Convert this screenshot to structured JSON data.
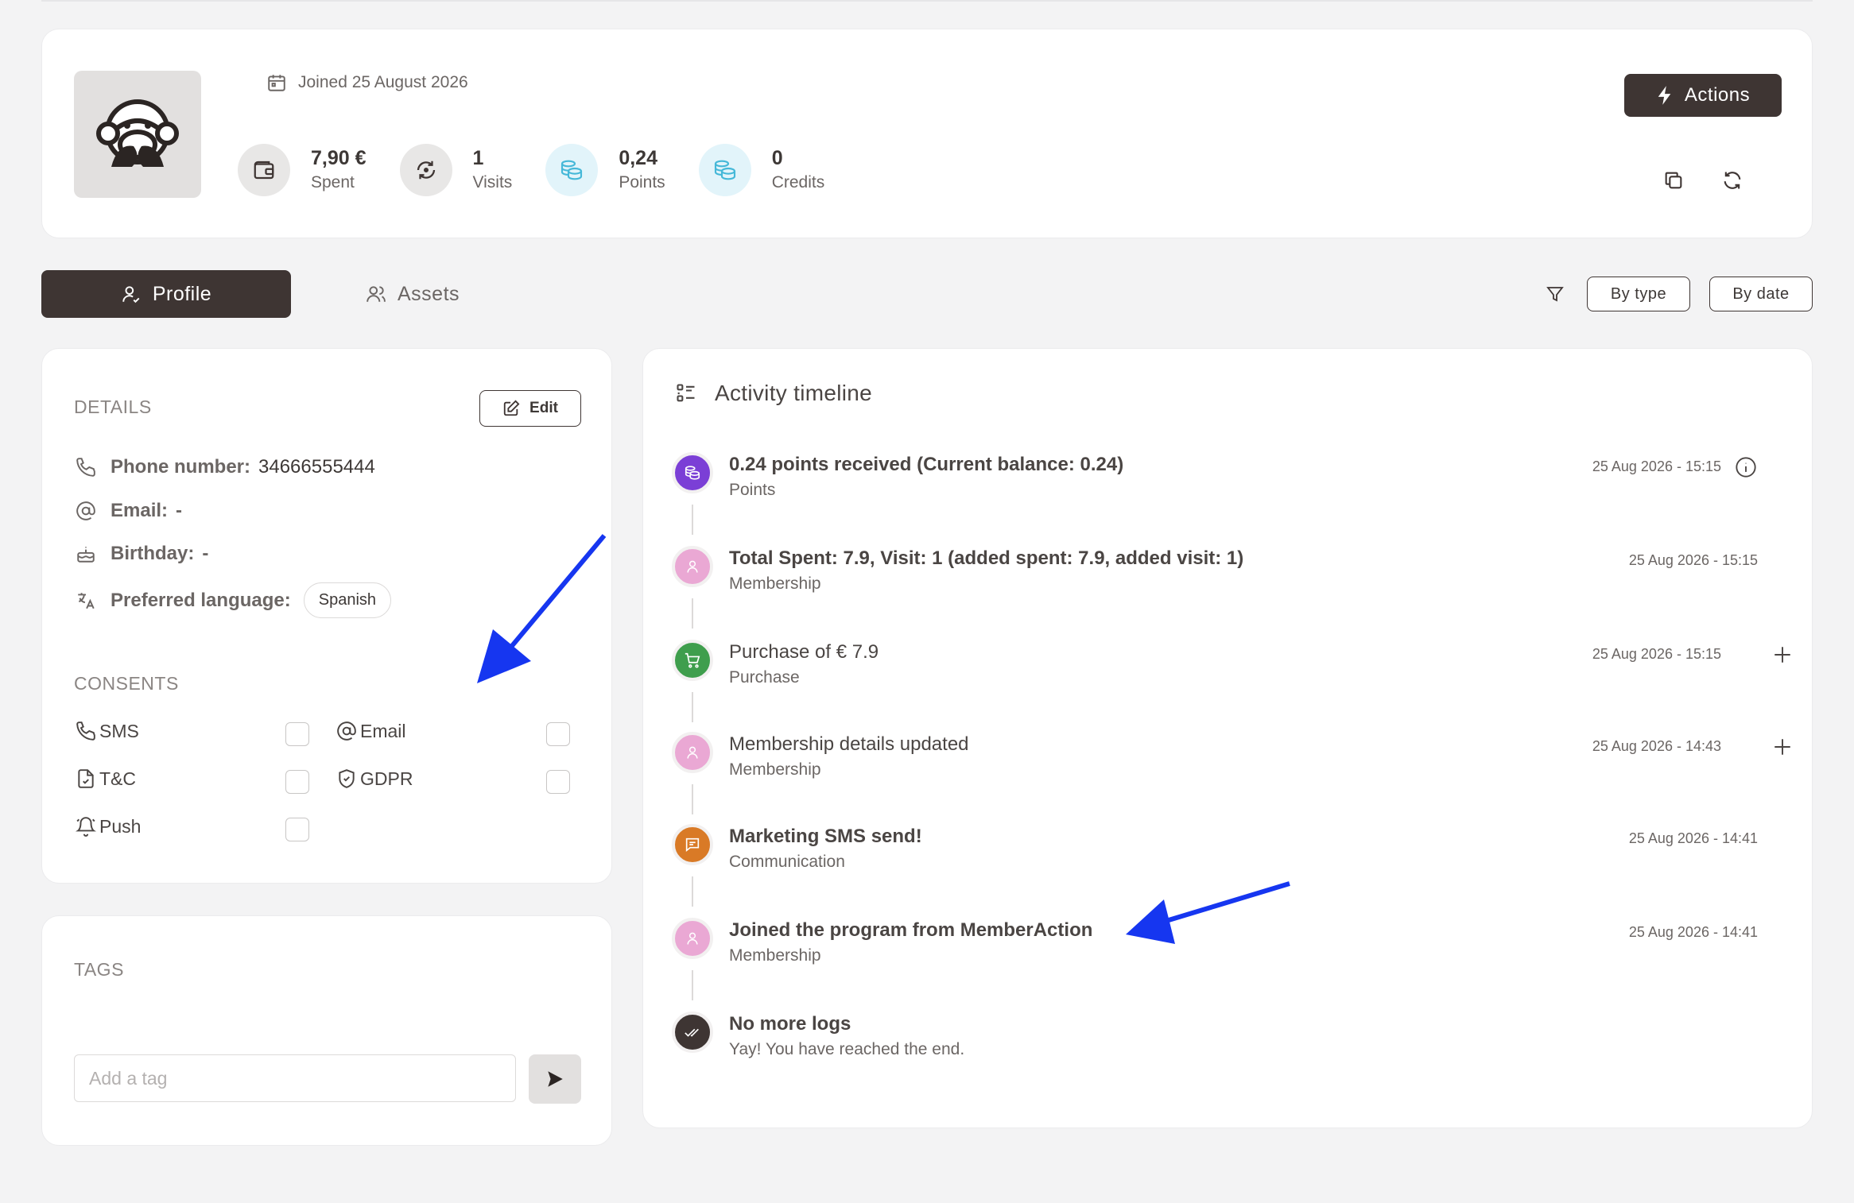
{
  "header": {
    "joined": "Joined 25 August 2026",
    "stats": [
      {
        "value": "7,90 €",
        "label": "Spent",
        "icon": "wallet-icon"
      },
      {
        "value": "1",
        "label": "Visits",
        "icon": "refresh-visits-icon"
      },
      {
        "value": "0,24",
        "label": "Points",
        "icon": "coins-icon"
      },
      {
        "value": "0",
        "label": "Credits",
        "icon": "coins-icon"
      }
    ],
    "actions_label": "Actions"
  },
  "tabs": {
    "profile": "Profile",
    "assets": "Assets",
    "by_type": "By type",
    "by_date": "By date"
  },
  "details": {
    "title": "DETAILS",
    "edit_label": "Edit",
    "phone_label": "Phone number:",
    "phone_value": "34666555444",
    "email_label": "Email:",
    "email_value": "-",
    "birthday_label": "Birthday:",
    "birthday_value": "-",
    "language_label": "Preferred language:",
    "language_value": "Spanish",
    "consents_title": "CONSENTS",
    "consents": {
      "sms": "SMS",
      "email": "Email",
      "tnc": "T&C",
      "gdpr": "GDPR",
      "push": "Push"
    }
  },
  "tags": {
    "title": "TAGS",
    "placeholder": "Add a tag"
  },
  "timeline": {
    "title": "Activity timeline",
    "items": [
      {
        "title": "0.24 points received (Current balance: 0.24)",
        "subtitle": "Points",
        "time": "25 Aug 2026 - 15:15",
        "color": "#7b3fd6"
      },
      {
        "title": "Total Spent: 7.9, Visit: 1 (added spent: 7.9, added visit: 1)",
        "subtitle": "Membership",
        "time": "25 Aug 2026 - 15:15",
        "color": "#eaa8d4"
      },
      {
        "title": "Purchase of € 7.9",
        "subtitle": "Purchase",
        "time": "25 Aug 2026 - 15:15",
        "color": "#3f9e4d"
      },
      {
        "title": "Membership details updated",
        "subtitle": "Membership",
        "time": "25 Aug 2026 - 14:43",
        "color": "#eaa8d4"
      },
      {
        "title": "Marketing SMS send!",
        "subtitle": "Communication",
        "time": "25 Aug 2026 - 14:41",
        "color": "#d97a26"
      },
      {
        "title": "Joined the program from MemberAction",
        "subtitle": "Membership",
        "time": "25 Aug 2026 - 14:41",
        "color": "#eaa8d4"
      },
      {
        "title": "No more logs",
        "subtitle": "Yay! You have reached the end.",
        "color": "#3e3533"
      }
    ]
  },
  "colors": {
    "primary": "#3e3533",
    "background": "#f3f3f4",
    "annotation_arrow": "#1636f0"
  }
}
